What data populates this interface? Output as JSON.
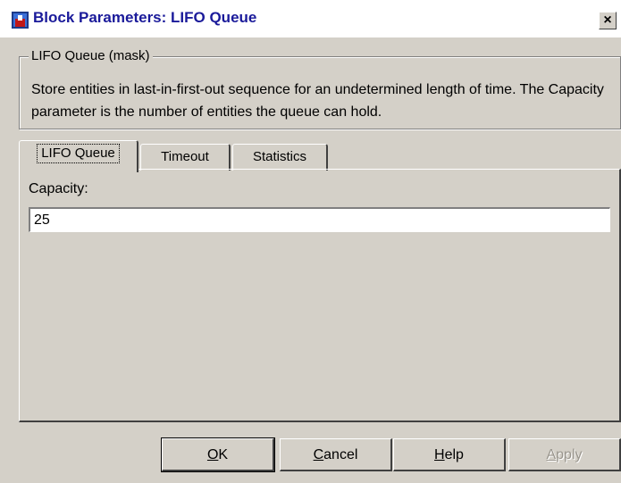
{
  "window": {
    "title": "Block Parameters: LIFO Queue",
    "icon": "simulink-block-icon",
    "close_label": "×"
  },
  "group": {
    "legend": "LIFO Queue (mask)",
    "description": "Store entities in last-in-first-out sequence for an undetermined length of time. The Capacity parameter is the number of entities the queue can hold."
  },
  "tabs": [
    {
      "label": "LIFO Queue",
      "active": true
    },
    {
      "label": "Timeout",
      "active": false
    },
    {
      "label": "Statistics",
      "active": false
    }
  ],
  "params": {
    "capacity_label": "Capacity:",
    "capacity_value": "25"
  },
  "buttons": {
    "ok": {
      "mnemonic": "O",
      "rest": "K"
    },
    "cancel": {
      "mnemonic": "C",
      "rest": "ancel"
    },
    "help": {
      "mnemonic": "H",
      "rest": "elp"
    },
    "apply": {
      "mnemonic": "A",
      "rest": "pply",
      "enabled": false
    }
  },
  "colors": {
    "title_text": "#1a1a9a",
    "dialog_bg": "#d4d0c8",
    "disabled_text": "#9a968e"
  }
}
